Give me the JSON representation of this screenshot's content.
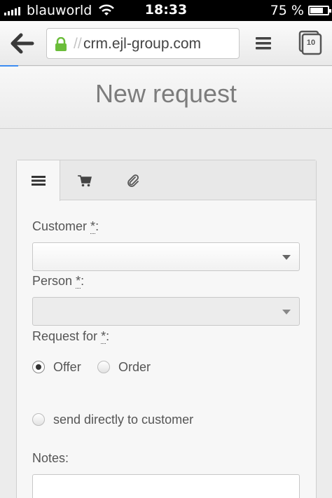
{
  "status_bar": {
    "carrier": "blauworld",
    "time": "18:33",
    "battery": "75 %",
    "battery_level": 0.75
  },
  "browser": {
    "url_prefix": "//",
    "url": "crm.ejl-group.com",
    "tabs_count": "10"
  },
  "page": {
    "title": "New request"
  },
  "form": {
    "customer_label": "Customer",
    "person_label": "Person",
    "request_for_label": "Request for",
    "required_mark": "*",
    "label_colon": ":",
    "options": [
      "Offer",
      "Order"
    ],
    "selected_option": "Offer",
    "send_directly_label": "send directly to customer",
    "notes_label": "Notes:"
  },
  "icons": {
    "tab_1": "list-icon",
    "tab_2": "cart-icon",
    "tab_3": "paperclip-icon",
    "back": "back-arrow-icon",
    "lock": "lock-icon",
    "menu": "menu-icon",
    "tabs": "tabs-icon"
  }
}
